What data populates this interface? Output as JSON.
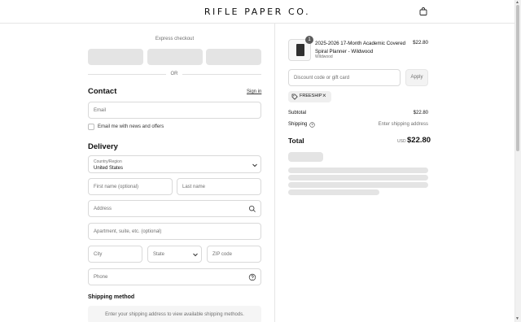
{
  "header": {
    "logo": "RIFLE PAPER CO."
  },
  "express_checkout": {
    "label": "Express checkout",
    "or": "OR"
  },
  "contact": {
    "title": "Contact",
    "sign_in": "Sign in",
    "email_placeholder": "Email",
    "newsletter_label": "Email me with news and offers"
  },
  "delivery": {
    "title": "Delivery",
    "country_caption": "Country/Region",
    "country_value": "United States",
    "first_name_placeholder": "First name (optional)",
    "last_name_placeholder": "Last name",
    "address_placeholder": "Address",
    "apartment_placeholder": "Apartment, suite, etc. (optional)",
    "city_placeholder": "City",
    "state_placeholder": "State",
    "zip_placeholder": "ZIP code",
    "phone_placeholder": "Phone"
  },
  "shipping_method": {
    "title": "Shipping method",
    "message": "Enter your shipping address to view available shipping methods."
  },
  "order": {
    "quantity": "1",
    "product_name": "2025-2026 17-Month Academic Covered Spiral Planner - Wildwood",
    "variant": "Wildwood",
    "price": "$22.80",
    "discount_placeholder": "Discount code or gift card",
    "apply_label": "Apply",
    "applied_code": "FREESHIP",
    "subtotal_label": "Subtotal",
    "subtotal_value": "$22.80",
    "shipping_label": "Shipping",
    "shipping_value": "Enter shipping address",
    "total_label": "Total",
    "total_currency": "USD",
    "total_value": "$22.80"
  }
}
